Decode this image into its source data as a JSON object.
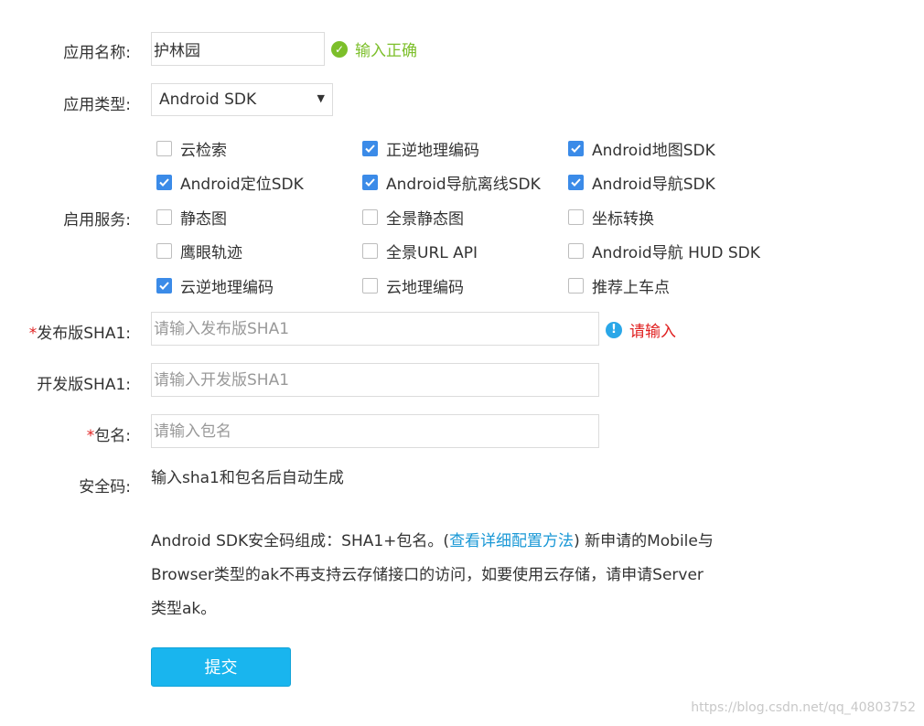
{
  "app_name": {
    "label": "应用名称:",
    "value": "护林园",
    "valid_text": "输入正确"
  },
  "app_type": {
    "label": "应用类型:",
    "selected": "Android SDK"
  },
  "services": {
    "label": "启用服务:",
    "items": [
      {
        "label": "云检索",
        "checked": false
      },
      {
        "label": "正逆地理编码",
        "checked": true
      },
      {
        "label": "Android地图SDK",
        "checked": true
      },
      {
        "label": "Android定位SDK",
        "checked": true
      },
      {
        "label": "Android导航离线SDK",
        "checked": true
      },
      {
        "label": "Android导航SDK",
        "checked": true
      },
      {
        "label": "静态图",
        "checked": false
      },
      {
        "label": "全景静态图",
        "checked": false
      },
      {
        "label": "坐标转换",
        "checked": false
      },
      {
        "label": "鹰眼轨迹",
        "checked": false
      },
      {
        "label": "全景URL API",
        "checked": false
      },
      {
        "label": "Android导航 HUD SDK",
        "checked": false
      },
      {
        "label": "云逆地理编码",
        "checked": true
      },
      {
        "label": "云地理编码",
        "checked": false
      },
      {
        "label": "推荐上车点",
        "checked": false
      }
    ]
  },
  "release_sha1": {
    "required_mark": "*",
    "label": "发布版SHA1:",
    "placeholder": "请输入发布版SHA1",
    "error_text": "请输入"
  },
  "dev_sha1": {
    "label": "开发版SHA1:",
    "placeholder": "请输入开发版SHA1"
  },
  "package": {
    "required_mark": "*",
    "label": "包名:",
    "placeholder": "请输入包名"
  },
  "security_code": {
    "label": "安全码:",
    "value": "输入sha1和包名后自动生成"
  },
  "info": {
    "text_before": "Android SDK安全码组成：SHA1+包名。(",
    "link": "查看详细配置方法",
    "text_after": ") 新申请的Mobile与Browser类型的ak不再支持云存储接口的访问，如要使用云存储，请申请Server类型ak。"
  },
  "submit_label": "提交",
  "watermark": "https://blog.csdn.net/qq_40803752",
  "colors": {
    "accent": "#19b5ee",
    "valid": "#7cbf2a",
    "error": "#e02020",
    "checkbox": "#3b8be8",
    "link": "#1a98d6"
  }
}
